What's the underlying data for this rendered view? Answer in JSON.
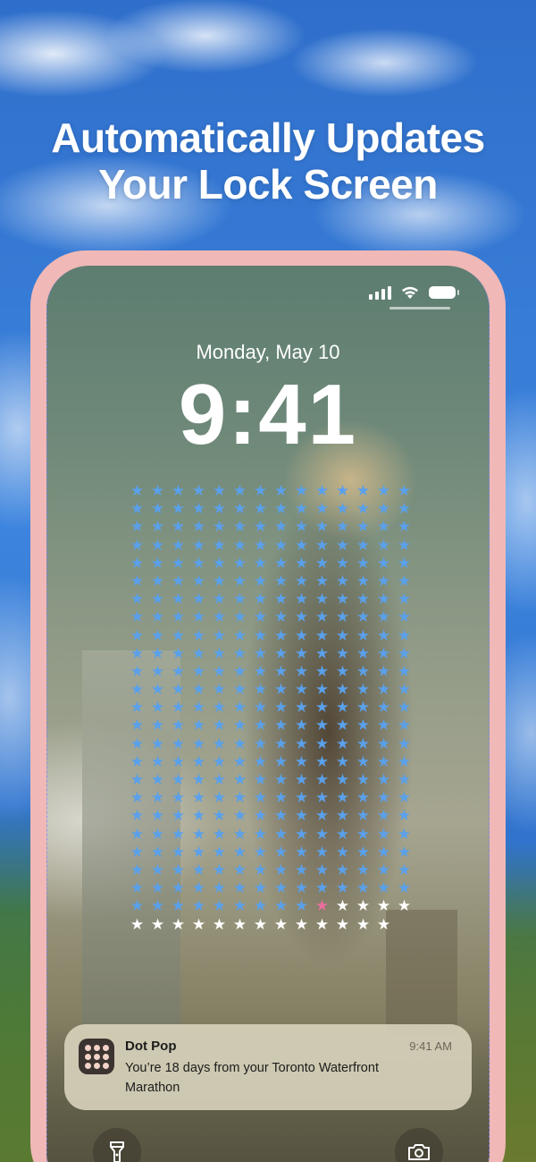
{
  "headline": {
    "line1": "Automatically Updates",
    "line2": "Your Lock Screen"
  },
  "lock_screen": {
    "date": "Monday, May 10",
    "time": "9:41",
    "status_icons": [
      "cellular-signal-icon",
      "wifi-icon",
      "battery-icon"
    ]
  },
  "star_grid": {
    "columns": 14,
    "blue_count": 331,
    "pink_count": 1,
    "white_count": 17,
    "colors": {
      "blue": "#5aa0ea",
      "white": "#ffffff",
      "pink": "#ea6f9d"
    },
    "glyph": "★"
  },
  "notification": {
    "app_name": "Dot Pop",
    "time": "9:41 AM",
    "message": "You’re 18 days from your Toronto Waterfront Marathon"
  },
  "quick_actions": [
    "flashlight-icon",
    "camera-icon"
  ],
  "colors": {
    "phone_frame": "#f0b8b6",
    "sky": "#3c84de"
  }
}
